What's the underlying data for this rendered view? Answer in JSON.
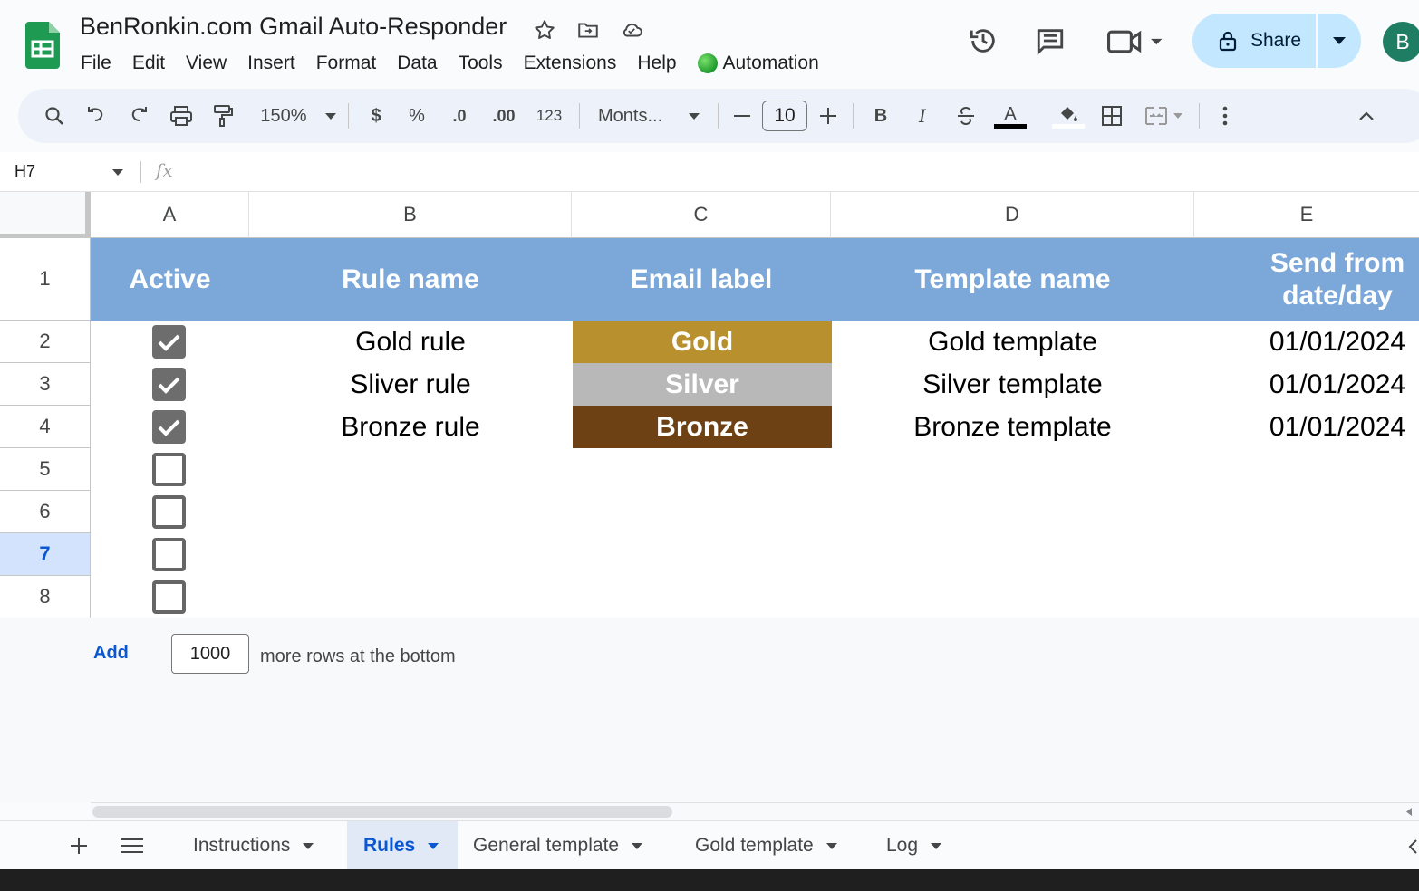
{
  "app": {
    "title": "BenRonkin.com Gmail Auto-Responder",
    "menu": [
      "File",
      "Edit",
      "View",
      "Insert",
      "Format",
      "Data",
      "Tools",
      "Extensions",
      "Help"
    ],
    "automation_label": "Automation",
    "share_label": "Share",
    "avatar_letter": "B"
  },
  "toolbar": {
    "zoom": "150%",
    "currency": "$",
    "percent": "%",
    "dec_decrease": ".0",
    "dec_increase": ".00",
    "number_format": "123",
    "font": "Monts...",
    "font_size": "10",
    "bold": "B",
    "italic": "I",
    "text_color": "A"
  },
  "formula_bar": {
    "cell_ref": "H7",
    "fx": "fx"
  },
  "columns": [
    "A",
    "B",
    "C",
    "D",
    "E"
  ],
  "rows": [
    "1",
    "2",
    "3",
    "4",
    "5",
    "6",
    "7",
    "8"
  ],
  "selected_row": "7",
  "header": {
    "active": "Active",
    "rule_name": "Rule name",
    "email_label": "Email label",
    "template_name": "Template name",
    "send_from": "Send from date/day"
  },
  "data_rows": [
    {
      "active": true,
      "rule": "Gold rule",
      "label": "Gold",
      "label_color": "#b8912e",
      "template": "Gold template",
      "date": "01/01/2024"
    },
    {
      "active": true,
      "rule": "Sliver rule",
      "label": "Silver",
      "label_color": "#b8b8b8",
      "template": "Silver template",
      "date": "01/01/2024"
    },
    {
      "active": true,
      "rule": "Bronze rule",
      "label": "Bronze",
      "label_color": "#6e4115",
      "template": "Bronze template",
      "date": "01/01/2024"
    },
    {
      "active": false
    },
    {
      "active": false
    },
    {
      "active": false
    },
    {
      "active": false
    }
  ],
  "add_rows": {
    "button": "Add",
    "count": "1000",
    "suffix": "more rows at the bottom"
  },
  "sheet_tabs": [
    {
      "name": "Instructions",
      "active": false
    },
    {
      "name": "Rules",
      "active": true
    },
    {
      "name": "General template",
      "active": false
    },
    {
      "name": "Gold template",
      "active": false
    },
    {
      "name": "Log",
      "active": false
    }
  ],
  "colors": {
    "header_bg": "#7ba7d9",
    "accent": "#0b57d0",
    "share_bg": "#c2e7ff"
  }
}
